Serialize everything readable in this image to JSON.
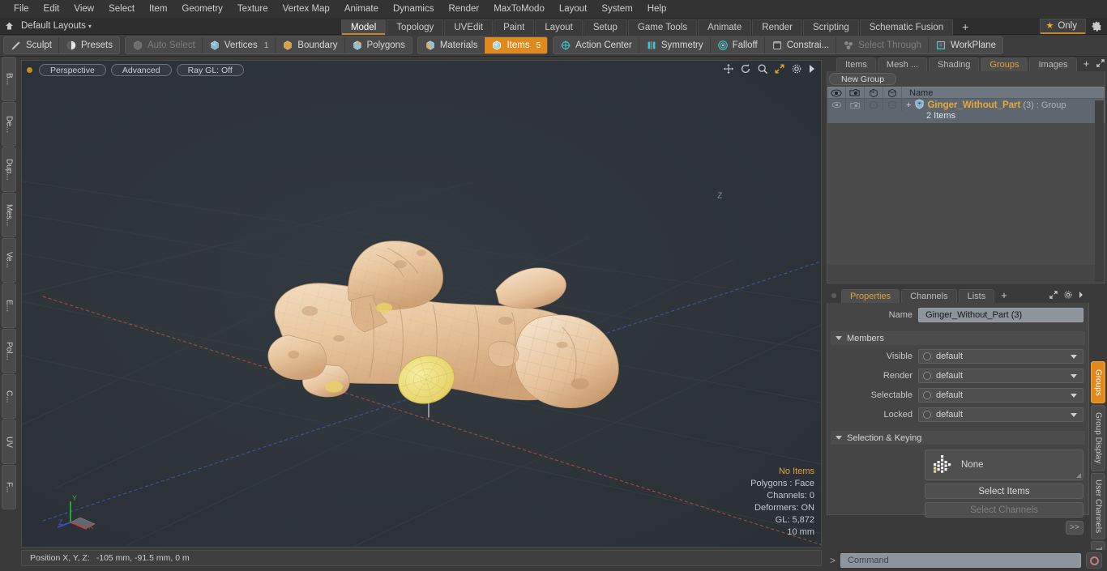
{
  "menubar": {
    "items": [
      "File",
      "Edit",
      "View",
      "Select",
      "Item",
      "Geometry",
      "Texture",
      "Vertex Map",
      "Animate",
      "Dynamics",
      "Render",
      "MaxToModo",
      "Layout",
      "System",
      "Help"
    ]
  },
  "layoutbar": {
    "home_icon": "home-icon",
    "layout_name": "Default Layouts",
    "caret": "▾",
    "tabs": [
      {
        "label": "Model",
        "active": true
      },
      {
        "label": "Topology",
        "active": false
      },
      {
        "label": "UVEdit",
        "active": false
      },
      {
        "label": "Paint",
        "active": false
      },
      {
        "label": "Layout",
        "active": false
      },
      {
        "label": "Setup",
        "active": false
      },
      {
        "label": "Game Tools",
        "active": false
      },
      {
        "label": "Animate",
        "active": false
      },
      {
        "label": "Render",
        "active": false
      },
      {
        "label": "Scripting",
        "active": false
      },
      {
        "label": "Schematic Fusion",
        "active": false
      }
    ],
    "add_tab": "+",
    "only_label": "Only",
    "star_glyph": "★",
    "gear_icon": "gear-icon"
  },
  "modebar": {
    "left_group": [
      {
        "label": "Sculpt",
        "icon": "pencil-icon",
        "state": "normal"
      },
      {
        "label": "Presets",
        "icon": "sphere-icon",
        "state": "normal"
      }
    ],
    "selection_group": [
      {
        "label": "Auto Select",
        "icon": "cube-gray-icon",
        "state": "disabled",
        "count": ""
      },
      {
        "label": "Vertices",
        "icon": "cube-blue-icon",
        "state": "normal",
        "count": "1"
      },
      {
        "label": "Boundary",
        "icon": "boundary-icon",
        "state": "normal",
        "count": ""
      },
      {
        "label": "Polygons",
        "icon": "cube-poly-icon",
        "state": "normal",
        "count": ""
      }
    ],
    "mode_group": [
      {
        "label": "Materials",
        "icon": "cube-materials-icon",
        "state": "normal",
        "count": ""
      },
      {
        "label": "Items",
        "icon": "cube-items-icon",
        "state": "active",
        "count": "5"
      }
    ],
    "right_group": [
      {
        "label": "Action Center",
        "icon": "action-center-icon",
        "state": "normal"
      },
      {
        "label": "Symmetry",
        "icon": "symmetry-icon",
        "state": "normal"
      },
      {
        "label": "Falloff",
        "icon": "falloff-icon",
        "state": "normal"
      },
      {
        "label": "Constrai...",
        "icon": "constraint-icon",
        "state": "normal"
      },
      {
        "label": "Select Through",
        "icon": "select-through-icon",
        "state": "disabled"
      },
      {
        "label": "WorkPlane",
        "icon": "workplane-icon",
        "state": "normal"
      }
    ]
  },
  "left_tabs": [
    "B...",
    "De...",
    "Dup...",
    "Mes...",
    "Ve...",
    "E...",
    "Pol...",
    "C...",
    "UV",
    "F..."
  ],
  "viewport": {
    "pills": [
      "Perspective",
      "Advanced",
      "Ray GL: Off"
    ],
    "icons": [
      "move-icon",
      "rotate-icon",
      "zoom-icon",
      "maximize-icon",
      "gear-icon",
      "play-icon"
    ],
    "stats": {
      "items": "No Items",
      "polygons": "Polygons : Face",
      "channels": "Channels: 0",
      "deformers": "Deformers: ON",
      "gl": "GL: 5,872",
      "scale": "10 mm"
    },
    "gizmo": {
      "x": "X",
      "y": "Y",
      "z": "Z"
    },
    "colors": {
      "background": "#2c3237",
      "grid": "#353c42",
      "x_axis": "#9c4a46",
      "z_axis": "#4050a8",
      "model_skin": "#e8c49c",
      "model_cut": "#ecd97a"
    }
  },
  "statusbar": {
    "position_label": "Position X, Y, Z:",
    "position_value": "-105 mm, -91.5 mm, 0 m"
  },
  "groups_panel": {
    "tabs": [
      {
        "label": "Items",
        "active": false
      },
      {
        "label": "Mesh ...",
        "active": false
      },
      {
        "label": "Shading",
        "active": false
      },
      {
        "label": "Groups",
        "active": true
      },
      {
        "label": "Images",
        "active": false
      }
    ],
    "add_tab": "+",
    "new_group_button": "New Group",
    "columns": [
      "eye-icon",
      "render-icon",
      "cube-outline-icon",
      "cube-outline-icon-2"
    ],
    "name_header": "Name",
    "rows": [
      {
        "expand": "+",
        "icon": "group-shield-icon",
        "name": "Ginger_Without_Part",
        "count": "(3)",
        "type": ": Group",
        "sub": "2 Items"
      }
    ]
  },
  "properties_panel": {
    "tabs": [
      {
        "label": "Properties",
        "active": true
      },
      {
        "label": "Channels",
        "active": false
      },
      {
        "label": "Lists",
        "active": false
      }
    ],
    "add_tab": "+",
    "name_label": "Name",
    "name_value": "Ginger_Without_Part (3)",
    "members_section": "Members",
    "member_rows": [
      {
        "label": "Visible",
        "value": "default"
      },
      {
        "label": "Render",
        "value": "default"
      },
      {
        "label": "Selectable",
        "value": "default"
      },
      {
        "label": "Locked",
        "value": "default"
      }
    ],
    "selection_section": "Selection & Keying",
    "none_label": "None",
    "none_icon": "pixel-grid-icon",
    "select_items_button": "Select Items",
    "select_channels_button": "Select Channels",
    "expand_button": ">>"
  },
  "right_tabs": [
    {
      "label": "Groups",
      "active": true
    },
    {
      "label": "Group Display",
      "active": false
    },
    {
      "label": "User Channels",
      "active": false
    },
    {
      "label": "Tags",
      "active": false
    }
  ],
  "commandbar": {
    "prompt": ">",
    "placeholder": "Command",
    "record_icon": "record-icon"
  }
}
